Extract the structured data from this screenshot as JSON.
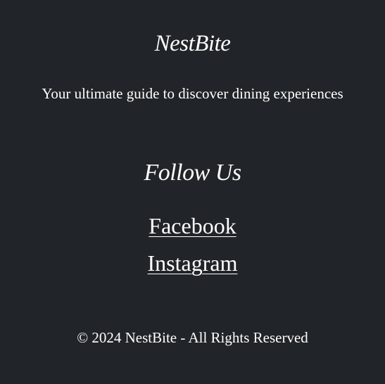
{
  "footer": {
    "brand": "NestBite",
    "tagline": "Your ultimate guide to discover dining experiences",
    "follow_heading": "Follow Us",
    "links": [
      {
        "label": "Facebook"
      },
      {
        "label": "Instagram"
      }
    ],
    "copyright": "© 2024 NestBite - All Rights Reserved"
  },
  "colors": {
    "background": "#212428",
    "text": "#ffffff"
  }
}
